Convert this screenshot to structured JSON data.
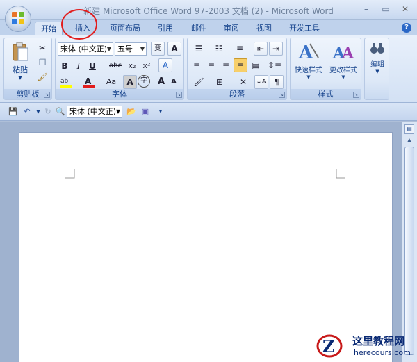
{
  "window": {
    "title": "新建 Microsoft Office Word 97-2003 文档 (2) - Microsoft Word",
    "min_label": "–",
    "max_label": "▭",
    "close_label": "✕"
  },
  "tabs": [
    {
      "label": "开始",
      "active": true
    },
    {
      "label": "插入",
      "active": false
    },
    {
      "label": "页面布局",
      "active": false
    },
    {
      "label": "引用",
      "active": false
    },
    {
      "label": "邮件",
      "active": false
    },
    {
      "label": "审阅",
      "active": false
    },
    {
      "label": "视图",
      "active": false
    },
    {
      "label": "开发工具",
      "active": false
    }
  ],
  "help_label": "?",
  "ribbon": {
    "clipboard": {
      "label": "剪贴板",
      "paste_label": "粘贴"
    },
    "font": {
      "label": "字体",
      "font_name": "宋体 (中文正)",
      "font_size": "五号",
      "bold": "B",
      "italic": "I",
      "underline": "U",
      "strike": "abc",
      "subscript": "x₂",
      "superscript": "x²",
      "text_effect": "Aa",
      "char_shade": "A",
      "enclose": "字",
      "grow": "A",
      "shrink": "A",
      "wen": "变",
      "border_a": "A",
      "clear": "A"
    },
    "paragraph": {
      "label": "段落"
    },
    "styles": {
      "label": "样式",
      "quick_styles": "快速样式",
      "change_styles": "更改样式"
    },
    "editing": {
      "label": "编辑"
    }
  },
  "qat": {
    "font_name": "宋体 (中文正)"
  },
  "watermark": {
    "cn": "这里教程网",
    "en": "herecours.com"
  },
  "colors": {
    "accent": "#15428b",
    "highlight": "#e21c1c"
  }
}
